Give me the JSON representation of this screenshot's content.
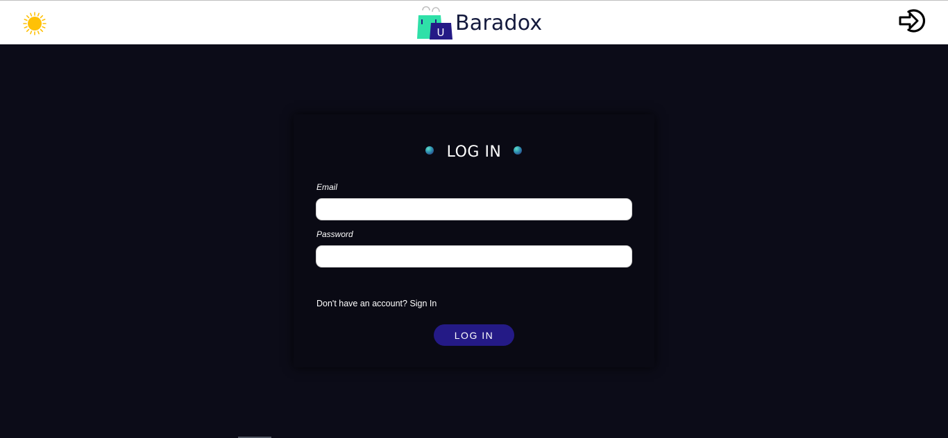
{
  "header": {
    "brand": "Baradox",
    "logo_badge_letter": "U",
    "theme_toggle_icon": "sun-icon",
    "login_icon": "sign-in-arrow-icon"
  },
  "login_card": {
    "title": "LOG IN",
    "email_label": "Email",
    "email_value": "",
    "password_label": "Password",
    "password_value": "",
    "no_account_text": "Don't have an account?",
    "signin_link": "Sign In",
    "submit_label": "LOG IN"
  },
  "colors": {
    "page_background": "#0c0c18",
    "card_background": "#0a0a14",
    "header_background": "#ffffff",
    "button": "#241a86",
    "sun": "#ffc107",
    "brand_text": "#141a3d",
    "bag_green": "#2fe0a8",
    "bag_navy": "#241a86"
  }
}
